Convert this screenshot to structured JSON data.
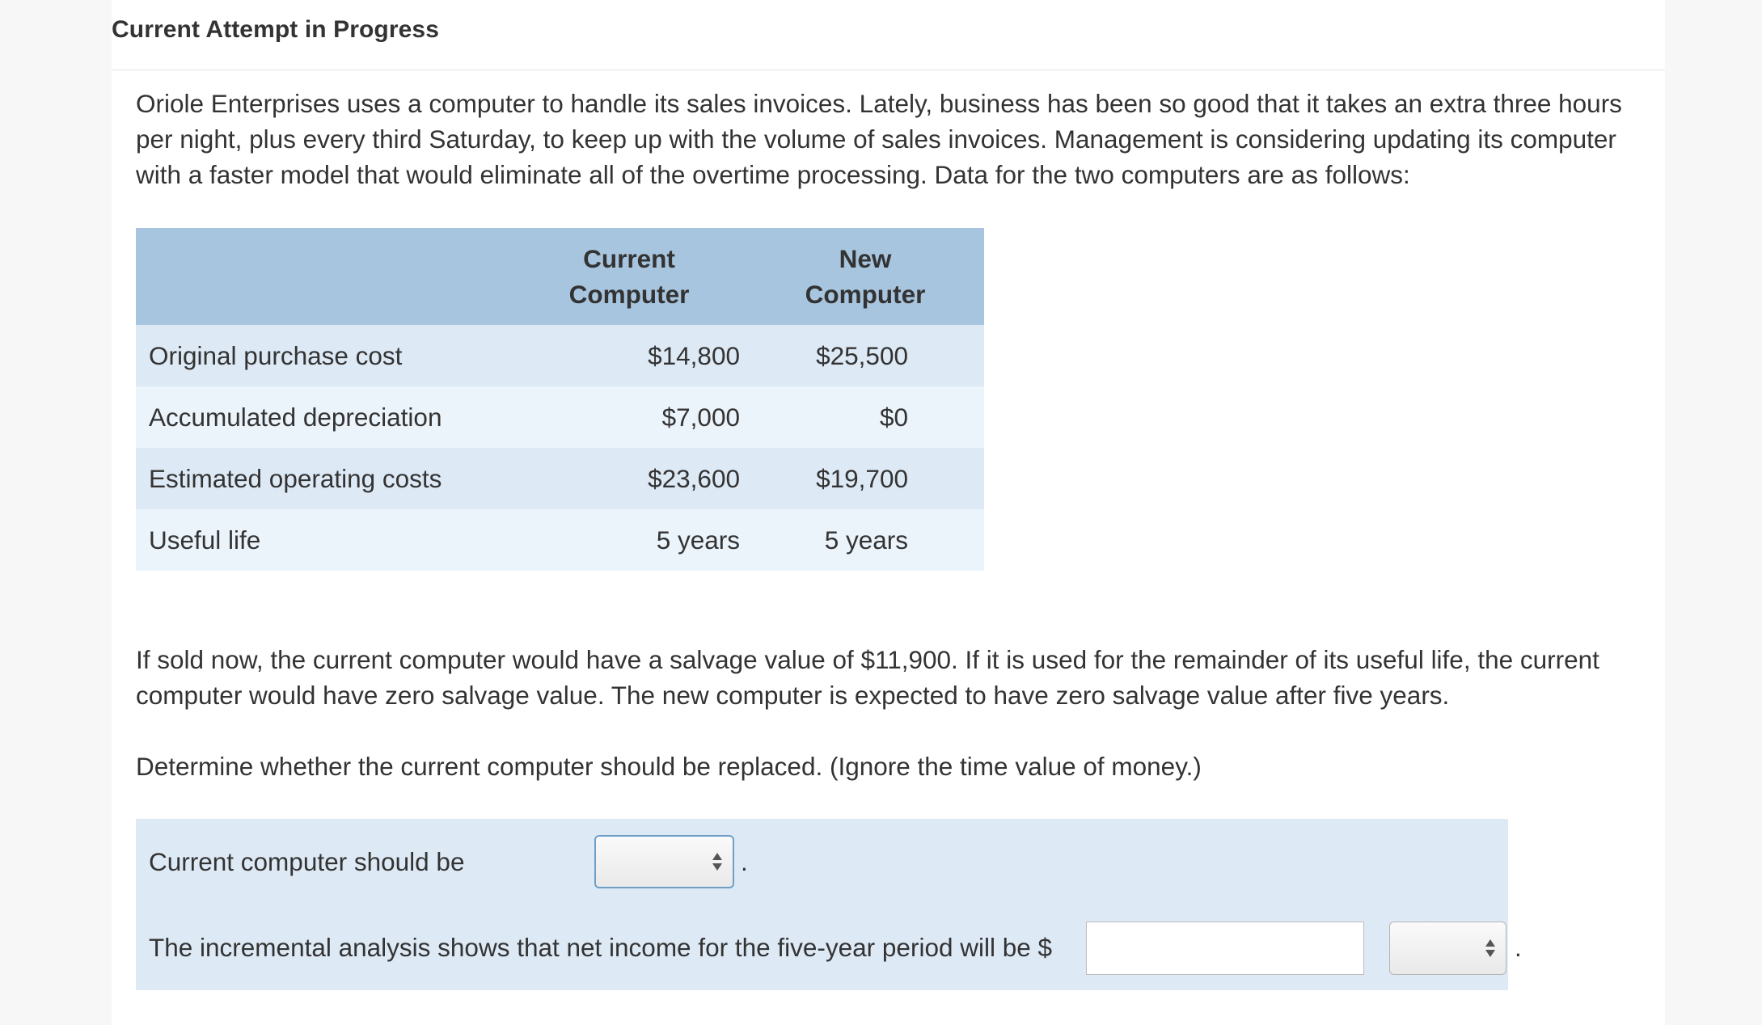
{
  "header": {
    "title": "Current Attempt in Progress"
  },
  "problem": {
    "intro": "Oriole Enterprises uses a computer to handle its sales invoices. Lately, business has been so good that it takes an extra three hours per night, plus every third Saturday, to keep up with the volume of sales invoices. Management is considering updating its computer with a faster model that would eliminate all of the overtime processing. Data for the two computers are as follows:",
    "salvage_text": "If sold now, the current computer would have a salvage value of $11,900. If it is used for the remainder of its useful life, the current computer would have zero salvage value. The new computer is expected to have zero salvage value after five years.",
    "instruction": "Determine whether the current computer should be replaced. (Ignore the time value of money.)"
  },
  "table": {
    "headers": {
      "current_line1": "Current",
      "current_line2": "Computer",
      "new_line1": "New",
      "new_line2": "Computer"
    },
    "rows": [
      {
        "label": "Original purchase cost",
        "current": "$14,800",
        "new": "$25,500"
      },
      {
        "label": "Accumulated depreciation",
        "current": "$7,000",
        "new": "$0"
      },
      {
        "label": "Estimated operating costs",
        "current": "$23,600",
        "new": "$19,700"
      },
      {
        "label": "Useful life",
        "current": "5 years",
        "new": "5 years"
      }
    ]
  },
  "answers": {
    "row1": {
      "label": "Current computer should be",
      "select_value": "",
      "suffix": "."
    },
    "row2": {
      "label": "The incremental analysis shows that net income for the five-year period will be $",
      "input_value": "",
      "input_placeholder": "",
      "select_value": "",
      "suffix": "."
    }
  },
  "icons": {
    "select_arrow": "up-down-arrows-icon"
  },
  "colors": {
    "table_header_bg": "#a7c5de",
    "row_dark_bg": "#dde9f5",
    "row_light_bg": "#ebf3fb",
    "focus_border": "#6e9fc9"
  }
}
